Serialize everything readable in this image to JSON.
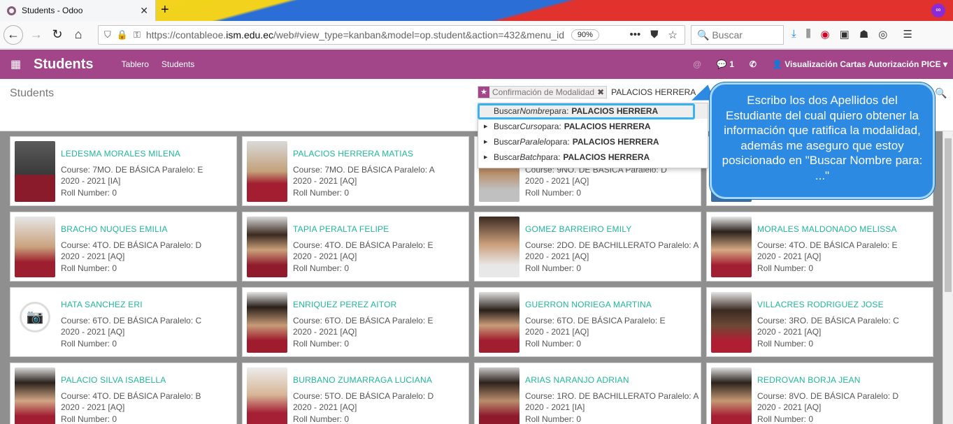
{
  "browser": {
    "tab_title": "Students - Odoo",
    "tab_close": "✕",
    "new_tab": "+",
    "url_prefix": "https://contableoe.",
    "url_domain": "ism.edu.ec",
    "url_rest": "/web#view_type=kanban&model=op.student&action=432&menu_id",
    "zoom": "90%",
    "search_placeholder": "Buscar"
  },
  "odoo": {
    "app_title": "Students",
    "menu": [
      "Tablero",
      "Students"
    ],
    "chat_count": "1",
    "user": "Visualización Cartas Autorización PICE"
  },
  "control": {
    "breadcrumb": "Students",
    "facet_label": "Confirmación de Modalidad",
    "search_text": "PALACIOS HERRERA"
  },
  "dropdown": [
    {
      "prefix": "Buscar ",
      "field": "Nombre",
      "mid": " para: ",
      "value": "PALACIOS HERRERA"
    },
    {
      "prefix": "Buscar ",
      "field": "Curso",
      "mid": " para: ",
      "value": "PALACIOS HERRERA"
    },
    {
      "prefix": "Buscar ",
      "field": "Paralelo",
      "mid": " para: ",
      "value": "PALACIOS HERRERA"
    },
    {
      "prefix": "Buscar ",
      "field": "Batch",
      "mid": " para: ",
      "value": "PALACIOS HERRERA"
    }
  ],
  "callout": "Escribo los dos Apellidos del Estudiante del cual quiero obtener la información que ratifica la modalidad, además me aseguro que estoy posicionado en \"Buscar Nombre para: ...\"",
  "students": [
    {
      "name": "LEDESMA MORALES MILENA",
      "course": "Course: 7MO. DE BÁSICA Paralelo: E",
      "year": "2020 - 2021 [IA]",
      "roll": "Roll Number: 0"
    },
    {
      "name": "PALACIOS HERRERA MATIAS",
      "course": "Course: 7MO. DE BÁSICA Paralelo: A",
      "year": "2020 - 2021 [AQ]",
      "roll": "Roll Number: 0"
    },
    {
      "name": "",
      "course": "Course: 9NO. DE BÁSICA Paralelo: D",
      "year": "2020 - 2021 [AQ]",
      "roll": "Roll Number: 0"
    },
    {
      "name": "",
      "course": "",
      "year": "",
      "roll": ""
    },
    {
      "name": "BRACHO NUQUES EMILIA",
      "course": "Course: 4TO. DE BÁSICA Paralelo: D",
      "year": "2020 - 2021 [AQ]",
      "roll": "Roll Number: 0"
    },
    {
      "name": "TAPIA PERALTA FELIPE",
      "course": "Course: 4TO. DE BÁSICA Paralelo: E",
      "year": "2020 - 2021 [AQ]",
      "roll": "Roll Number: 0"
    },
    {
      "name": "GOMEZ BARREIRO EMILY",
      "course": "Course: 2DO. DE BACHILLERATO Paralelo: A",
      "year": "2020 - 2021 [AQ]",
      "roll": "Roll Number: 0"
    },
    {
      "name": "MORALES MALDONADO MELISSA",
      "course": "Course: 4TO. DE BÁSICA Paralelo: E",
      "year": "2020 - 2021 [AQ]",
      "roll": "Roll Number: 0"
    },
    {
      "name": "HATA SANCHEZ ERI",
      "course": "Course: 6TO. DE BÁSICA Paralelo: C",
      "year": "2020 - 2021 [AQ]",
      "roll": "Roll Number: 0"
    },
    {
      "name": "ENRIQUEZ PEREZ AITOR",
      "course": "Course: 6TO. DE BÁSICA Paralelo: E",
      "year": "2020 - 2021 [AQ]",
      "roll": "Roll Number: 0"
    },
    {
      "name": "GUERRON NORIEGA MARTINA",
      "course": "Course: 6TO. DE BÁSICA Paralelo: E",
      "year": "2020 - 2021 [AQ]",
      "roll": "Roll Number: 0"
    },
    {
      "name": "VILLACRES RODRIGUEZ JOSE",
      "course": "Course: 3RO. DE BÁSICA Paralelo: C",
      "year": "2020 - 2021 [AQ]",
      "roll": "Roll Number: 0"
    },
    {
      "name": "PALACIO SILVA ISABELLA",
      "course": "Course: 4TO. DE BÁSICA Paralelo: B",
      "year": "2020 - 2021 [AQ]",
      "roll": "Roll Number: 0"
    },
    {
      "name": "BURBANO ZUMARRAGA LUCIANA",
      "course": "Course: 5TO. DE BÁSICA Paralelo: D",
      "year": "2020 - 2021 [AQ]",
      "roll": "Roll Number: 0"
    },
    {
      "name": "ARIAS NARANJO ADRIAN",
      "course": "Course: 1RO. DE BACHILLERATO Paralelo: A",
      "year": "2020 - 2021 [IA]",
      "roll": "Roll Number: 0"
    },
    {
      "name": "REDROVAN BORJA JEAN",
      "course": "Course: 8VO. DE BÁSICA Paralelo: D",
      "year": "2020 - 2021 [AQ]",
      "roll": "Roll Number: 0"
    }
  ]
}
